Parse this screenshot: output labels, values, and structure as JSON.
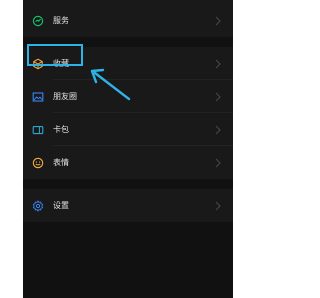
{
  "menu": {
    "items": [
      {
        "label": "服务",
        "icon": "service-icon"
      },
      {
        "label": "收藏",
        "icon": "favorites-icon"
      },
      {
        "label": "朋友圈",
        "icon": "moments-icon"
      },
      {
        "label": "卡包",
        "icon": "cards-icon"
      },
      {
        "label": "表情",
        "icon": "sticker-icon"
      },
      {
        "label": "设置",
        "icon": "settings-icon"
      }
    ]
  },
  "colors": {
    "service": "#14c16b",
    "favorites": "#f4a93b",
    "moments": "#3a86f6",
    "cards": "#2ba9d6",
    "sticker": "#f4b03c",
    "settings": "#3a86f6",
    "highlight": "#2fb3e6"
  }
}
